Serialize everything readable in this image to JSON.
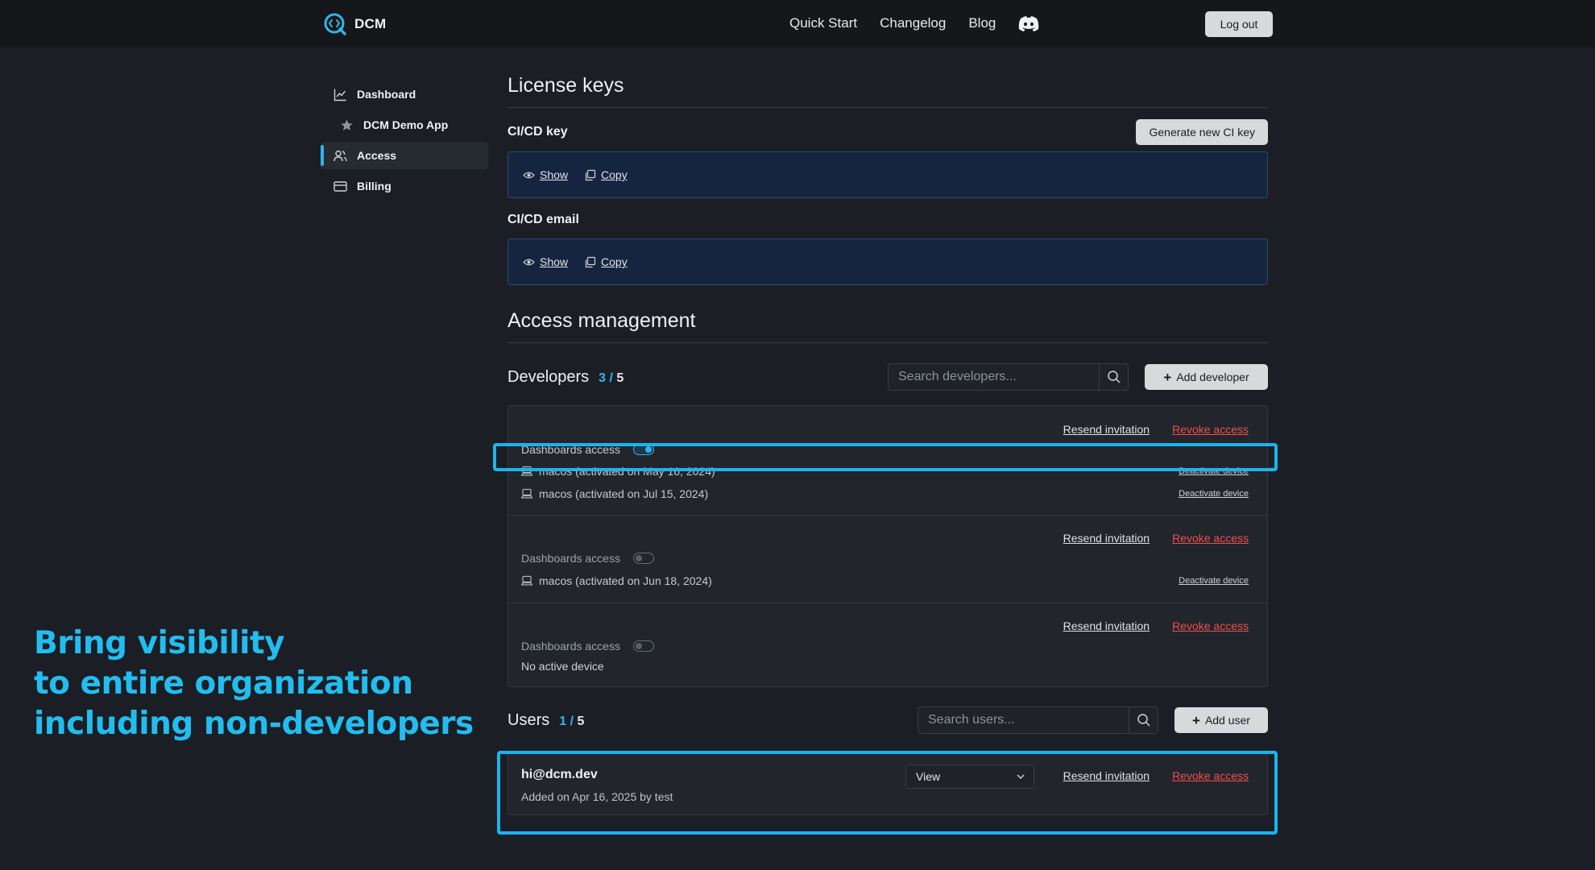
{
  "brand": {
    "name": "DCM"
  },
  "nav": {
    "links": [
      "Quick Start",
      "Changelog",
      "Blog"
    ],
    "logout_label": "Log out"
  },
  "sidebar": {
    "items": [
      {
        "label": "Dashboard",
        "icon": "chart-line-icon"
      },
      {
        "label": "DCM Demo App",
        "icon": "star-icon"
      },
      {
        "label": "Access",
        "icon": "users-icon",
        "active": true
      },
      {
        "label": "Billing",
        "icon": "credit-card-icon"
      }
    ]
  },
  "license": {
    "title": "License keys",
    "generate_label": "Generate new CI key",
    "ci_key": {
      "label": "CI/CD key",
      "show": "Show",
      "copy": "Copy"
    },
    "ci_email": {
      "label": "CI/CD email",
      "show": "Show",
      "copy": "Copy"
    }
  },
  "access": {
    "title": "Access management",
    "developers": {
      "title": "Developers",
      "count_current": "3",
      "count_sep": " / ",
      "count_max": "5",
      "search_placeholder": "Search developers...",
      "add_label": "Add developer",
      "rows": [
        {
          "resend": "Resend invitation",
          "revoke": "Revoke access",
          "dashboards_label": "Dashboards access",
          "dashboards_on": true,
          "devices": [
            {
              "text": "macos (activated on May 16, 2024)",
              "action": "Deactivate device"
            },
            {
              "text": "macos (activated on Jul 15, 2024)",
              "action": "Deactivate device"
            }
          ]
        },
        {
          "resend": "Resend invitation",
          "revoke": "Revoke access",
          "dashboards_label": "Dashboards access",
          "dashboards_on": false,
          "devices": [
            {
              "text": "macos (activated on Jun 18, 2024)",
              "action": "Deactivate device"
            }
          ]
        },
        {
          "resend": "Resend invitation",
          "revoke": "Revoke access",
          "dashboards_label": "Dashboards access",
          "dashboards_on": false,
          "no_device": "No active device"
        }
      ]
    },
    "users": {
      "title": "Users",
      "count_current": "1",
      "count_sep": " / ",
      "count_max": "5",
      "search_placeholder": "Search users...",
      "add_label": "Add user",
      "rows": [
        {
          "email": "hi@dcm.dev",
          "added": "Added on Apr 16, 2025 by test",
          "role": "View",
          "resend": "Resend invitation",
          "revoke": "Revoke access"
        }
      ]
    }
  },
  "promo": {
    "lines": [
      "Bring visibility",
      "to entire organization",
      "including non-developers"
    ]
  },
  "colors": {
    "accent": "#22bdf0",
    "danger": "#ef4f4f",
    "key_box": "#16253f",
    "background": "#1b1e24"
  }
}
